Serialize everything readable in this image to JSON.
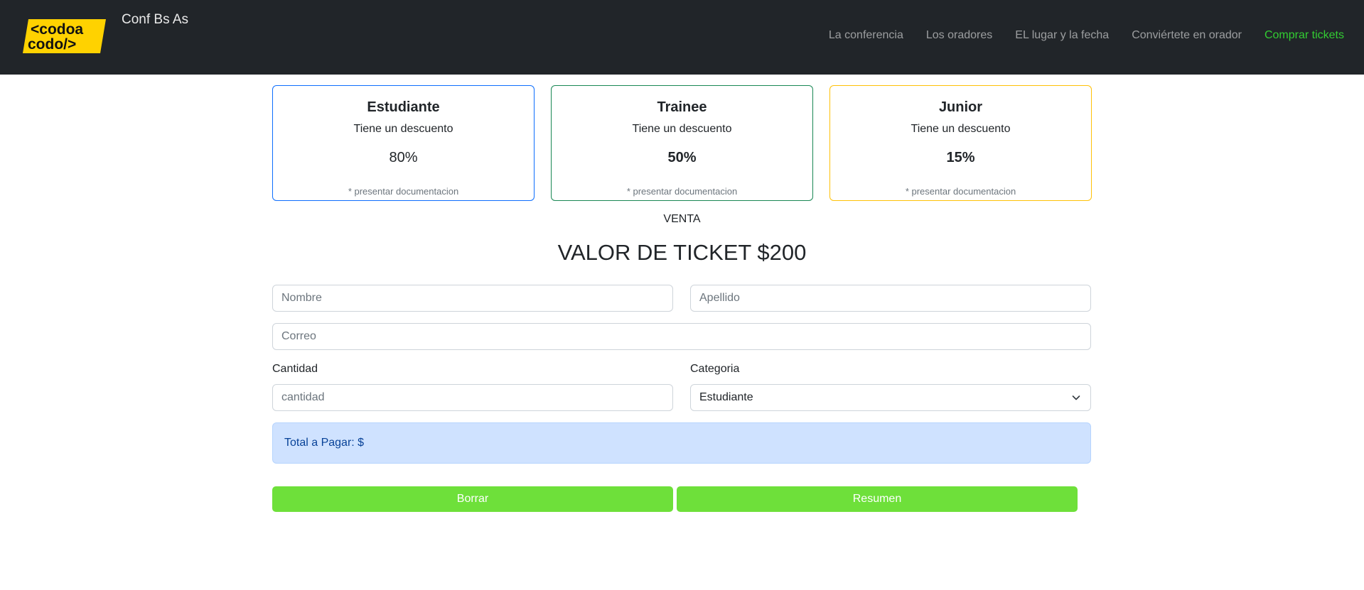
{
  "brand": {
    "logo_top": "<codoa",
    "logo_bottom": "codo/>",
    "name": "Conf Bs As"
  },
  "nav": {
    "items": [
      {
        "label": "La conferencia"
      },
      {
        "label": "Los oradores"
      },
      {
        "label": "EL lugar y la fecha"
      },
      {
        "label": "Conviértete en orador"
      },
      {
        "label": "Comprar tickets",
        "active": true
      }
    ]
  },
  "cards": [
    {
      "title": "Estudiante",
      "subtitle": "Tiene un descuento",
      "discount": "80%",
      "note": "* presentar documentacion"
    },
    {
      "title": "Trainee",
      "subtitle": "Tiene un descuento",
      "discount": "50%",
      "note": "* presentar documentacion"
    },
    {
      "title": "Junior",
      "subtitle": "Tiene un descuento",
      "discount": "15%",
      "note": "* presentar documentacion"
    }
  ],
  "sale": {
    "heading": "VENTA",
    "title": "VALOR DE TICKET $200"
  },
  "form": {
    "nombre_placeholder": "Nombre",
    "apellido_placeholder": "Apellido",
    "correo_placeholder": "Correo",
    "cantidad_label": "Cantidad",
    "cantidad_placeholder": "cantidad",
    "categoria_label": "Categoria",
    "categoria_value": "Estudiante"
  },
  "total": {
    "text": "Total a Pagar: $"
  },
  "buttons": {
    "clear": "Borrar",
    "summary": "Resumen"
  },
  "colors": {
    "navbar": "#212529",
    "active_link": "#32cd32",
    "button": "#6ee03a",
    "card1_border": "#0d6efd",
    "card2_border": "#198754",
    "card3_border": "#ffc107",
    "alert_bg": "#cfe2ff"
  }
}
